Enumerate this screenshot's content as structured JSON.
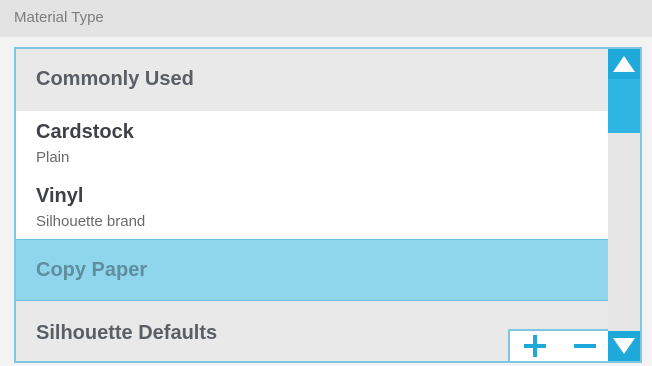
{
  "header": {
    "label": "Material Type"
  },
  "list": {
    "group_common": "Commonly Used",
    "items": [
      {
        "title": "Cardstock",
        "subtitle": "Plain"
      },
      {
        "title": "Vinyl",
        "subtitle": "Silhouette brand"
      }
    ],
    "selected": "Copy Paper",
    "group_defaults": "Silhouette Defaults"
  },
  "scrollbar": {
    "up_icon": "arrow-up-icon",
    "down_icon": "arrow-down-icon"
  },
  "tools": {
    "add_icon": "plus-icon",
    "remove_icon": "minus-icon"
  },
  "colors": {
    "accent": "#1ea9da",
    "selection": "#8fd6ec",
    "border": "#7ec6e2"
  }
}
